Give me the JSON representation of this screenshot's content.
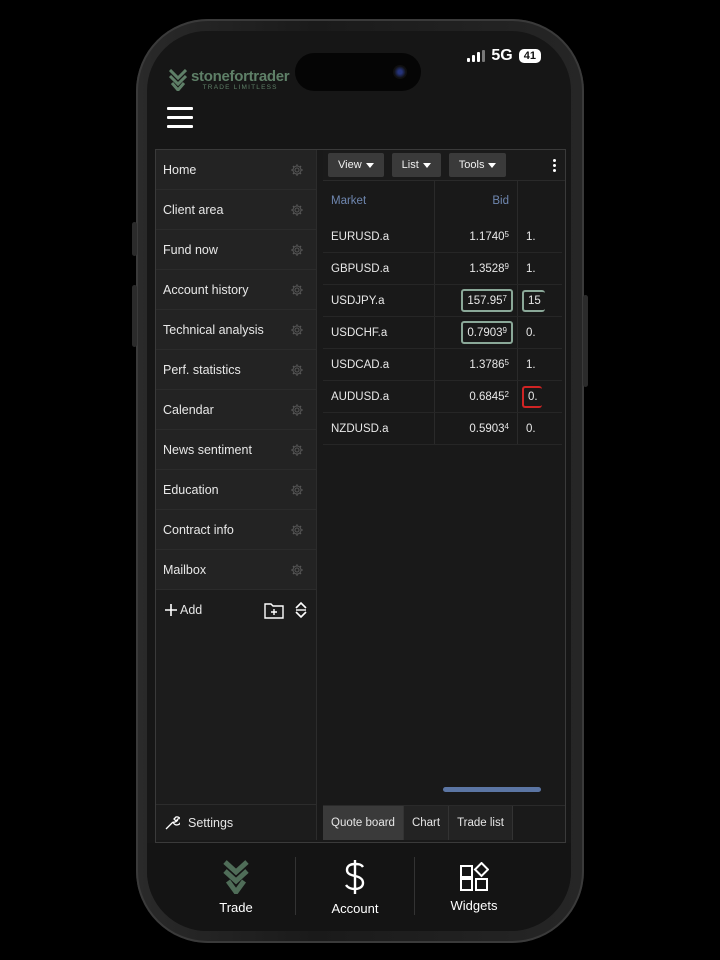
{
  "status_bar": {
    "network": "5G",
    "battery": "41"
  },
  "brand": {
    "name": "stonefortrader",
    "tagline": "TRADE LIMITLESS"
  },
  "sidebar": {
    "items": [
      {
        "label": "Home"
      },
      {
        "label": "Client area"
      },
      {
        "label": "Fund now"
      },
      {
        "label": "Account history"
      },
      {
        "label": "Technical analysis"
      },
      {
        "label": "Perf. statistics"
      },
      {
        "label": "Calendar"
      },
      {
        "label": "News sentiment"
      },
      {
        "label": "Education"
      },
      {
        "label": "Contract info"
      },
      {
        "label": "Mailbox"
      }
    ],
    "add_label": "Add",
    "settings_label": "Settings"
  },
  "toolbar": {
    "view": "View",
    "list": "List",
    "tools": "Tools"
  },
  "quote_board": {
    "headers": {
      "market": "Market",
      "bid": "Bid"
    },
    "rows": [
      {
        "market": "EURUSD.a",
        "bid": "1.1740",
        "bid_sup": "5",
        "ask_partial": "1.",
        "bid_state": "none",
        "ask_state": "none"
      },
      {
        "market": "GBPUSD.a",
        "bid": "1.3528",
        "bid_sup": "9",
        "ask_partial": "1.",
        "bid_state": "none",
        "ask_state": "none"
      },
      {
        "market": "USDJPY.a",
        "bid": "157.95",
        "bid_sup": "7",
        "ask_partial": "15",
        "bid_state": "up",
        "ask_state": "up"
      },
      {
        "market": "USDCHF.a",
        "bid": "0.7903",
        "bid_sup": "9",
        "ask_partial": "0.",
        "bid_state": "up",
        "ask_state": "none"
      },
      {
        "market": "USDCAD.a",
        "bid": "1.3786",
        "bid_sup": "5",
        "ask_partial": "1.",
        "bid_state": "none",
        "ask_state": "none"
      },
      {
        "market": "AUDUSD.a",
        "bid": "0.6845",
        "bid_sup": "2",
        "ask_partial": "0.",
        "bid_state": "none",
        "ask_state": "down"
      },
      {
        "market": "NZDUSD.a",
        "bid": "0.5903",
        "bid_sup": "4",
        "ask_partial": "0.",
        "bid_state": "none",
        "ask_state": "none"
      }
    ]
  },
  "bottom_tabs": [
    {
      "label": "Quote board",
      "active": true
    },
    {
      "label": "Chart",
      "active": false
    },
    {
      "label": "Trade list",
      "active": false
    }
  ],
  "nav": {
    "trade": "Trade",
    "account": "Account",
    "widgets": "Widgets"
  },
  "colors": {
    "background": "#161616",
    "brand_green": "#5e7f67",
    "accent_blue": "#6f87b0",
    "up_border": "#8aa898",
    "down_border": "#d02424"
  }
}
